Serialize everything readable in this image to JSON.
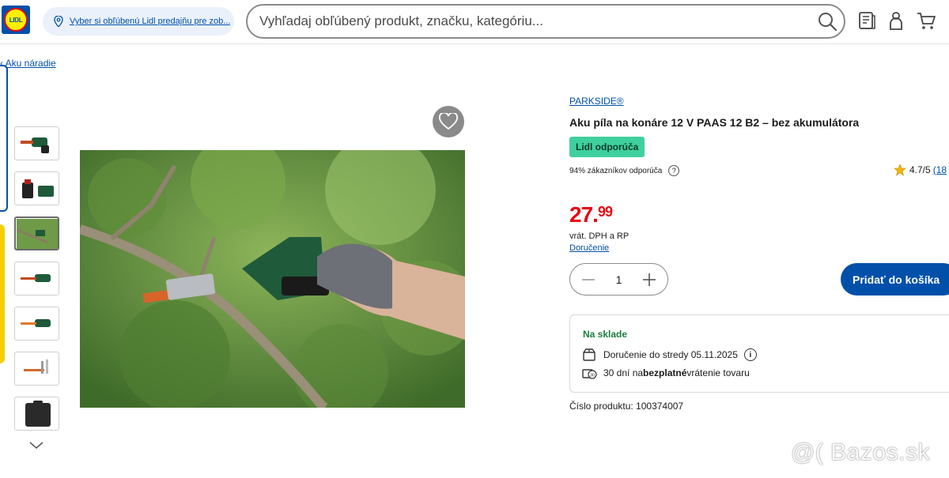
{
  "header": {
    "logo_text": "LIDL",
    "store_link": "Vyber si obľúbenú Lidl predajňu pre zob...",
    "search": {
      "placeholder": "Vyhľadaj obľúbený produkt, značku, kategóriu..."
    },
    "icons": [
      "search-icon",
      "leaflet-icon",
      "user-icon",
      "cart-icon"
    ]
  },
  "breadcrumb": {
    "label": "Aku náradie"
  },
  "thumbnails": [
    {
      "name": "thumb-saw-side"
    },
    {
      "name": "thumb-battery-charger"
    },
    {
      "name": "thumb-branch-cutting"
    },
    {
      "name": "thumb-saw-green"
    },
    {
      "name": "thumb-saw-orange"
    },
    {
      "name": "thumb-blades"
    },
    {
      "name": "thumb-case"
    }
  ],
  "product": {
    "brand": "PARKSIDE®",
    "title": "Aku píla na konáre 12 V PAAS 12 B2 – bez akumulátora",
    "badge": "Lidl odporúča",
    "recommend_text": "94% zákazníkov odporúča",
    "rating": "4.7/5",
    "rating_count": "(18",
    "price_main": "27.",
    "price_cents": "99",
    "vat_text": "vrát. DPH a RP",
    "delivery_link": "Doručenie",
    "quantity": "1",
    "add_to_cart": "Pridať do košíka",
    "stock": {
      "title": "Na sklade",
      "delivery": "Doručenie do stredy 05.11.2025",
      "return_prefix": "30 dní na ",
      "return_bold": "bezplatné",
      "return_suffix": " vrátenie tovaru"
    },
    "product_number": "Číslo produktu: 100374007"
  },
  "watermark": "@( Bazos.sk",
  "colors": {
    "brand_blue": "#0050aa",
    "price_red": "#e60a14",
    "badge_green": "#3fd09e",
    "stock_green": "#1c7c3c"
  }
}
